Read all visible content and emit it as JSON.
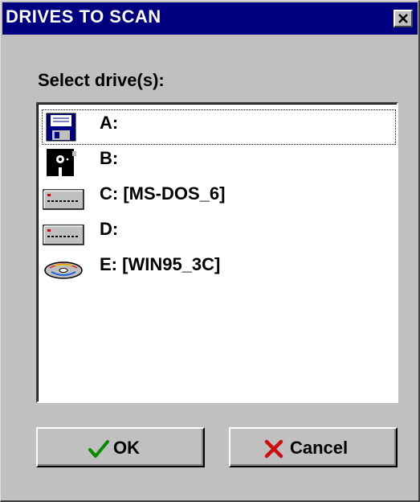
{
  "window": {
    "title": "DRIVES TO SCAN"
  },
  "prompt": "Select drive(s):",
  "drives": [
    {
      "label": "A:",
      "icon": "floppy-35-icon"
    },
    {
      "label": "B:",
      "icon": "floppy-525-icon"
    },
    {
      "label": "C: [MS-DOS_6]",
      "icon": "hard-drive-icon"
    },
    {
      "label": "D:",
      "icon": "hard-drive-icon"
    },
    {
      "label": "E: [WIN95_3C]",
      "icon": "cd-rom-icon"
    }
  ],
  "buttons": {
    "ok": "OK",
    "cancel": "Cancel"
  },
  "colors": {
    "titlebar": "#000080",
    "face": "#c0c0c0",
    "ok_check": "#0a8a00",
    "cancel_x": "#cc1010"
  }
}
